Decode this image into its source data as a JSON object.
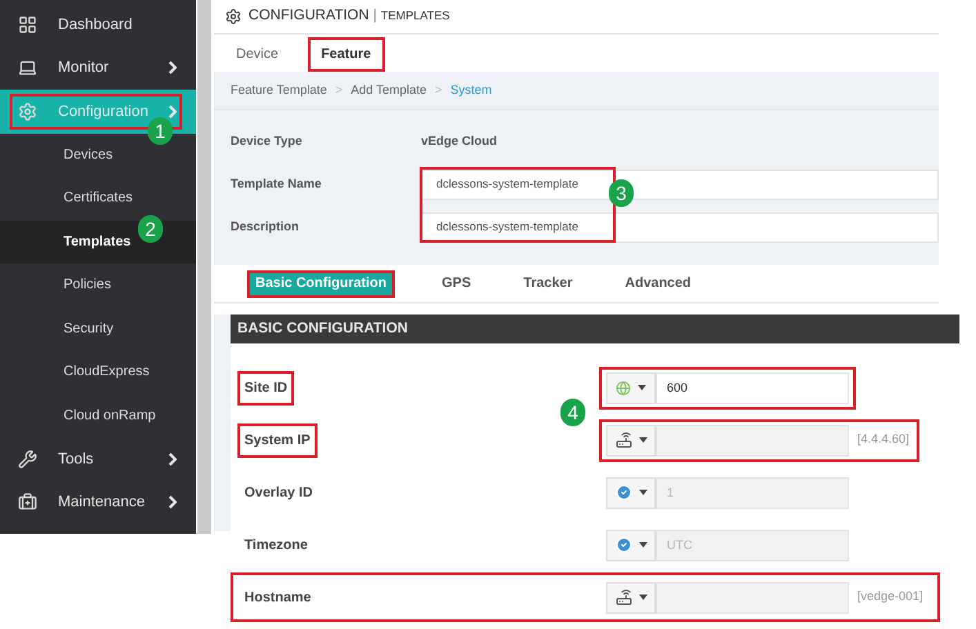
{
  "sidebar": {
    "items": [
      {
        "label": "Dashboard",
        "expandable": false,
        "selected": false,
        "highlighted": false
      },
      {
        "label": "Monitor",
        "expandable": true,
        "selected": false,
        "highlighted": false
      },
      {
        "label": "Configuration",
        "expandable": true,
        "selected": true,
        "highlighted": true,
        "marker": "1",
        "children": [
          {
            "label": "Devices",
            "selected": false
          },
          {
            "label": "Certificates",
            "selected": false
          },
          {
            "label": "Templates",
            "selected": true,
            "marker": "2"
          },
          {
            "label": "Policies",
            "selected": false
          },
          {
            "label": "Security",
            "selected": false
          },
          {
            "label": "CloudExpress",
            "selected": false
          },
          {
            "label": "Cloud onRamp",
            "selected": false
          }
        ]
      },
      {
        "label": "Tools",
        "expandable": true,
        "selected": false,
        "highlighted": false
      },
      {
        "label": "Maintenance",
        "expandable": true,
        "selected": false,
        "highlighted": false
      }
    ]
  },
  "header": {
    "title": "CONFIGURATION",
    "separator": "|",
    "subtitle": "TEMPLATES"
  },
  "tabs": [
    {
      "label": "Device",
      "selected": false,
      "highlighted": false
    },
    {
      "label": "Feature",
      "selected": true,
      "highlighted": true
    }
  ],
  "breadcrumb": {
    "separator": ">",
    "items": [
      {
        "label": "Feature Template",
        "current": false
      },
      {
        "label": "Add Template",
        "current": false
      },
      {
        "label": "System",
        "current": true
      }
    ]
  },
  "template_info": {
    "device_type": {
      "label": "Device Type",
      "value": "vEdge Cloud"
    },
    "template_name": {
      "label": "Template Name",
      "value": "dclessons-system-template"
    },
    "description": {
      "label": "Description",
      "value": "dclessons-system-template"
    },
    "highlighted": true,
    "marker": "3"
  },
  "section_tabs": [
    {
      "label": "Basic Configuration",
      "selected": true,
      "highlighted": true
    },
    {
      "label": "GPS",
      "selected": false,
      "highlighted": false
    },
    {
      "label": "Tracker",
      "selected": false,
      "highlighted": false
    },
    {
      "label": "Advanced",
      "selected": false,
      "highlighted": false
    }
  ],
  "section": {
    "title": "BASIC CONFIGURATION",
    "fields": [
      {
        "label": "Site ID",
        "kind": "global",
        "value": "600",
        "label_highlighted": true,
        "control_highlighted": true,
        "row_highlighted": false,
        "marker": "4"
      },
      {
        "label": "System IP",
        "kind": "device",
        "hint": "[4.4.4.60]",
        "label_highlighted": true,
        "control_highlighted": true,
        "row_highlighted": false
      },
      {
        "label": "Overlay ID",
        "kind": "default",
        "placeholder": "1",
        "label_highlighted": false,
        "control_highlighted": false,
        "row_highlighted": false
      },
      {
        "label": "Timezone",
        "kind": "default",
        "placeholder": "UTC",
        "label_highlighted": false,
        "control_highlighted": false,
        "row_highlighted": false
      },
      {
        "label": "Hostname",
        "kind": "device",
        "hint": "[vedge-001]",
        "label_highlighted": false,
        "control_highlighted": false,
        "row_highlighted": true
      }
    ]
  }
}
